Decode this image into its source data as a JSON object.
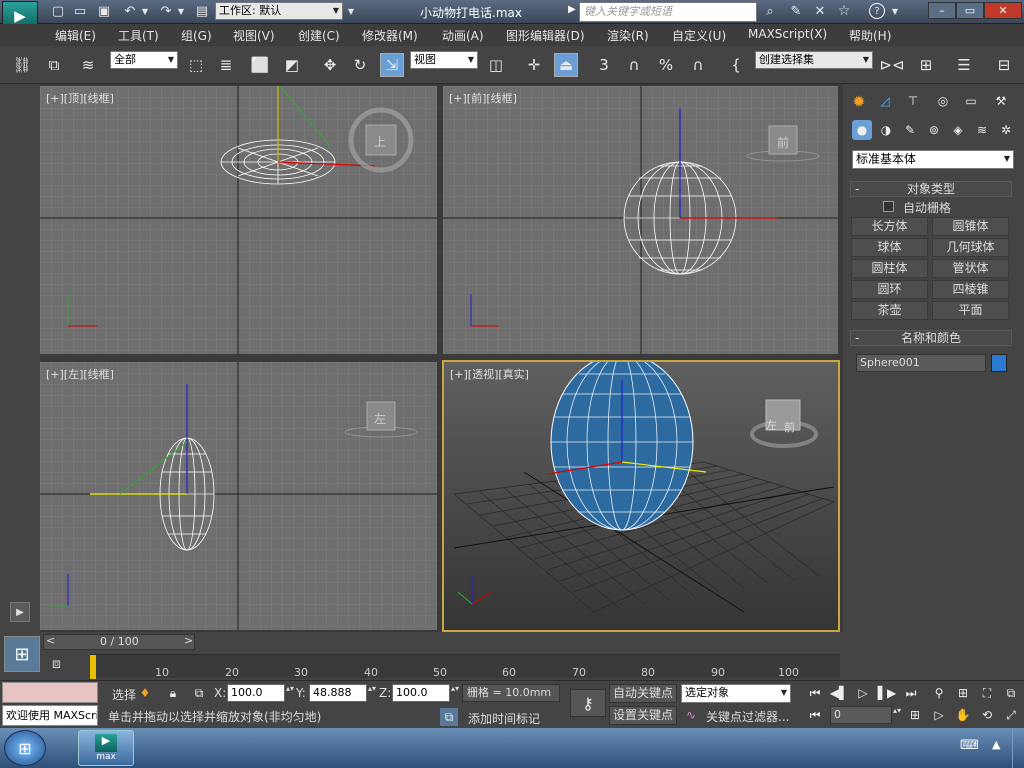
{
  "titlebar": {
    "workspace_label": "工作区: 默认",
    "file_title": "小动物打电话.max",
    "search_placeholder": "键入关键字或短语"
  },
  "menu": {
    "items": [
      "编辑(E)",
      "工具(T)",
      "组(G)",
      "视图(V)",
      "创建(C)",
      "修改器(M)",
      "动画(A)",
      "图形编辑器(D)",
      "渲染(R)",
      "自定义(U)",
      "MAXScript(X)",
      "帮助(H)"
    ]
  },
  "toolbar": {
    "selection_filter": "全部",
    "ref_coord": "视图",
    "snap_3": "3",
    "percent": "%",
    "named_selection": "创建选择集"
  },
  "viewports": {
    "top": {
      "label": "[+][顶][线框]",
      "cube_face": "上"
    },
    "front": {
      "label": "[+][前][线框]",
      "cube_face": "前"
    },
    "left": {
      "label": "[+][左][线框]",
      "cube_face": "左"
    },
    "persp": {
      "label": "[+][透视][真实]",
      "cube_face_left": "左",
      "cube_face_front": "前"
    }
  },
  "command_panel": {
    "category": "标准基本体",
    "object_type_header": "对象类型",
    "autogrid_label": "自动栅格",
    "buttons": [
      "长方体",
      "圆锥体",
      "球体",
      "几何球体",
      "圆柱体",
      "管状体",
      "圆环",
      "四棱锥",
      "茶壶",
      "平面"
    ],
    "name_color_header": "名称和颜色",
    "object_name": "Sphere001",
    "object_color": "#2a7ad0"
  },
  "timeline": {
    "frame_counter": "0 / 100",
    "ticks": [
      "10",
      "20",
      "30",
      "40",
      "50",
      "60",
      "70",
      "80",
      "90",
      "100"
    ]
  },
  "status": {
    "welcome": "欢迎使用 MAXScri",
    "select_label": "选择",
    "x_label": "X:",
    "x_value": "100.0",
    "y_label": "Y:",
    "y_value": "48.888",
    "z_label": "Z:",
    "z_value": "100.0",
    "grid": "栅格 = 10.0mm",
    "auto_key": "自动关键点",
    "set_key": "设置关键点",
    "selected_filter": "选定对象",
    "key_filters": "关键点过滤器...",
    "prompt": "单击并拖动以选择并缩放对象(非均匀地)",
    "add_time_tag": "添加时间标记",
    "current_frame": "0"
  },
  "taskbar": {
    "app_label": "max"
  }
}
